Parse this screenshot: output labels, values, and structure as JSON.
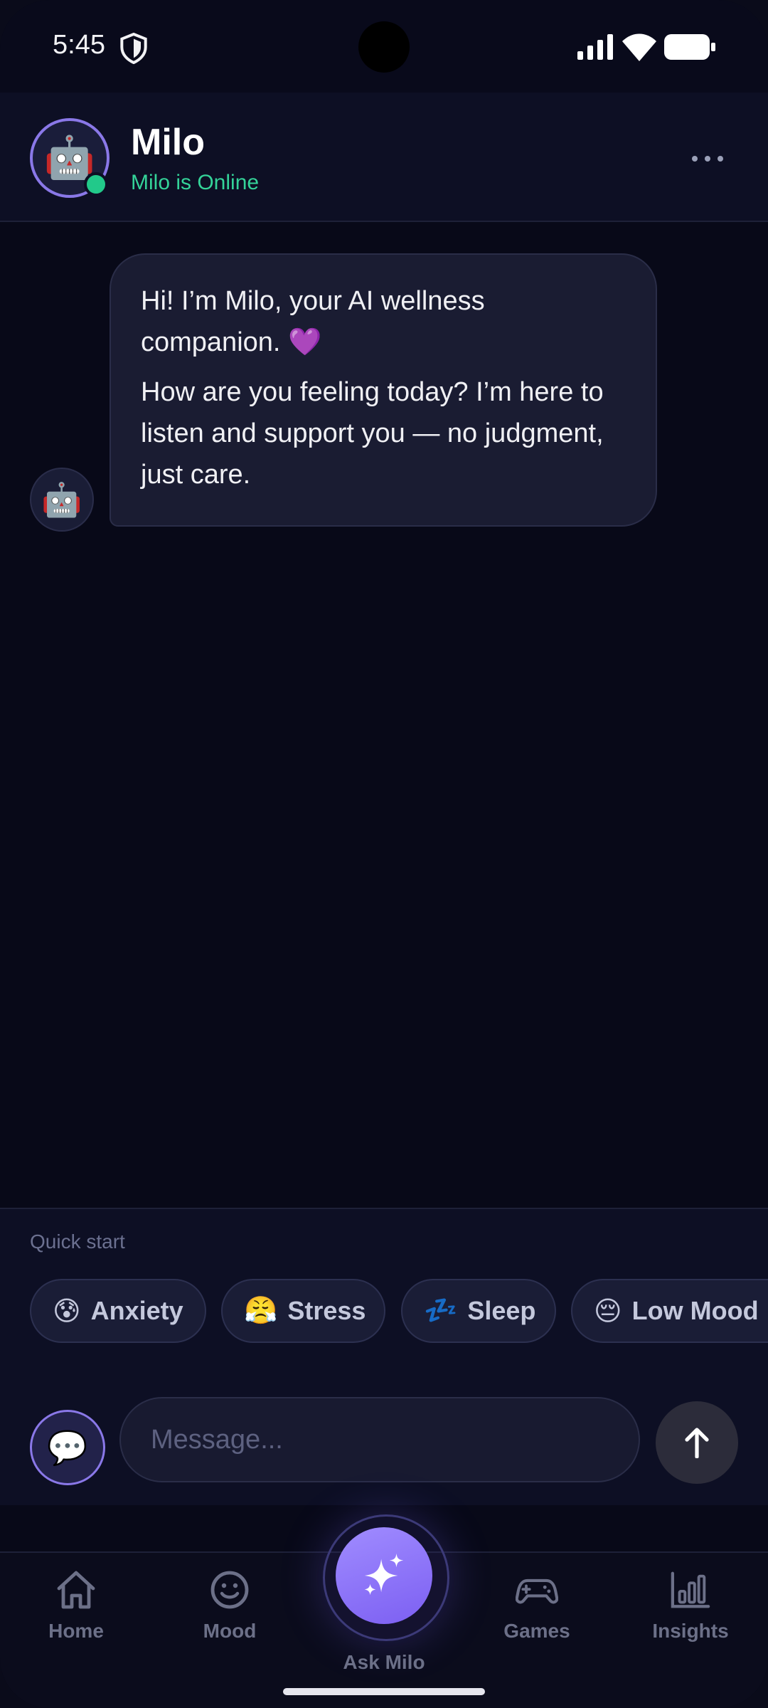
{
  "status_bar": {
    "time": "5:45"
  },
  "header": {
    "name": "Milo",
    "status": "Milo is Online",
    "avatar_emoji": "🤖"
  },
  "messages": [
    {
      "sender": "bot",
      "avatar_emoji": "🤖",
      "paragraphs": [
        "Hi! I’m Milo, your AI wellness companion. 💜",
        "How are you feeling today? I’m here to listen and support you — no judgment, just care."
      ]
    }
  ],
  "quick_start": {
    "label": "Quick start",
    "chips": [
      {
        "emoji": "😰",
        "label": "Anxiety"
      },
      {
        "emoji": "😤",
        "label": "Stress"
      },
      {
        "emoji": "💤",
        "label": "Sleep"
      },
      {
        "emoji": "😔",
        "label": "Low Mood"
      }
    ]
  },
  "composer": {
    "placeholder": "Message...",
    "chat_icon_emoji": "💬",
    "send_symbol": "↑"
  },
  "nav": {
    "items": [
      {
        "label": "Home",
        "icon": "home-icon"
      },
      {
        "label": "Mood",
        "icon": "smiley-icon"
      },
      {
        "label": "Ask Milo",
        "icon": "sparkle-icon",
        "active": true
      },
      {
        "label": "Games",
        "icon": "gamepad-icon"
      },
      {
        "label": "Insights",
        "icon": "bar-chart-icon"
      }
    ]
  },
  "colors": {
    "accent": "#8a78e8",
    "online": "#34d399",
    "background": "#080918"
  }
}
